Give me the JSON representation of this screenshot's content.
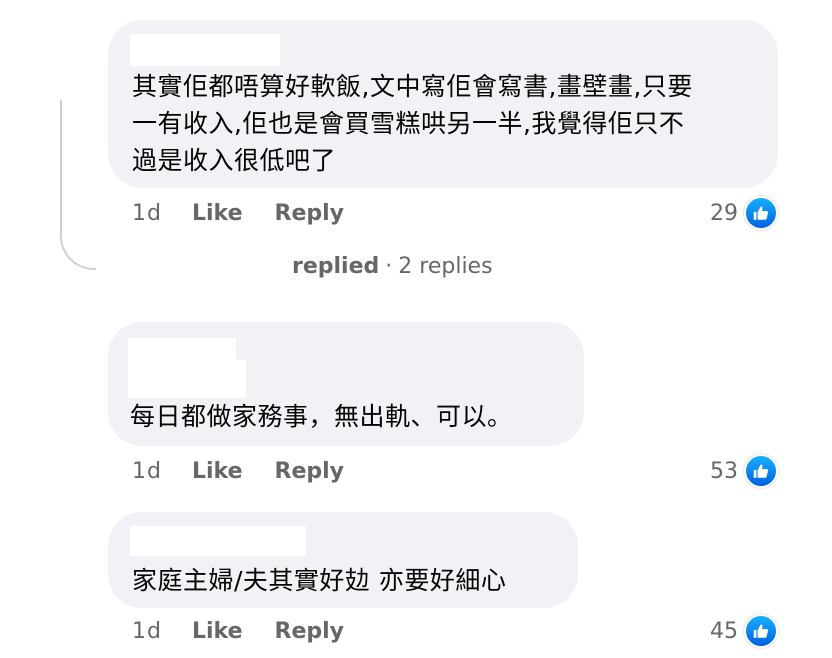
{
  "comments": [
    {
      "text_lines": [
        "其實佢都唔算好軟飯,文中寫佢會寫書,畫壁畫,只要",
        "一有收入,佢也是會買雪糕哄另一半,我覺得佢只不",
        "過是收入很低吧了"
      ],
      "time": "1d",
      "like_label": "Like",
      "reply_label": "Reply",
      "reactions": "29",
      "icon": "thumbs-up-icon"
    },
    {
      "text_lines": [
        "每日都做家務事，無出軌、可以。"
      ],
      "time": "1d",
      "like_label": "Like",
      "reply_label": "Reply",
      "reactions": "53",
      "icon": "thumbs-up-icon"
    },
    {
      "text_lines": [
        "家庭主婦/夫其實好攰 亦要好細心"
      ],
      "time": "1d",
      "like_label": "Like",
      "reply_label": "Reply",
      "reactions": "45",
      "icon": "thumbs-up-icon"
    }
  ],
  "replies_link": {
    "replied": "replied",
    "separator": "·",
    "count": "2 replies"
  },
  "colors": {
    "bubble": "#f0f2f5",
    "text": "#050505",
    "meta": "#65676b",
    "like_blue": "#1877f2"
  }
}
